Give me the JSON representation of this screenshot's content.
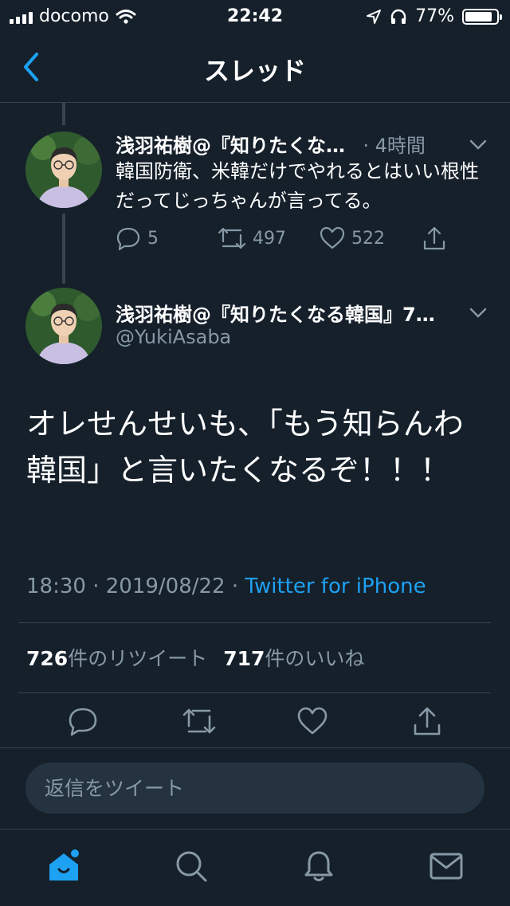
{
  "status_bar": {
    "carrier": "docomo",
    "time": "22:42",
    "battery": "77%"
  },
  "nav": {
    "title": "スレッド"
  },
  "reply_tweet": {
    "name": "浅羽祐樹@『知りたくな…",
    "time": "· 4時間",
    "text": "韓国防衛、米韓だけでやれるとはいい根性だってじっちゃんが言ってる。",
    "replies": "5",
    "retweets": "497",
    "likes": "522"
  },
  "main_tweet": {
    "name": "浅羽祐樹@『知りたくなる韓国』7…",
    "handle": "@YukiAsaba",
    "text": "オレせんせいも、「もう知らんわ韓国」と言いたくなるぞ！！！",
    "time": "18:30",
    "date": "2019/08/22",
    "source": "Twitter for iPhone",
    "retweet_count": "726",
    "retweet_label": "件のリツイート",
    "like_count": "717",
    "like_label": "件のいいね"
  },
  "composer": {
    "placeholder": "返信をツイート"
  },
  "colors": {
    "background": "#15202b",
    "accent": "#1da1f2",
    "muted": "#8899a6",
    "divider": "#38444d"
  },
  "icons": [
    "back-chevron-icon",
    "reply-icon",
    "retweet-icon",
    "like-icon",
    "share-icon",
    "home-icon",
    "search-icon",
    "notifications-icon",
    "messages-icon"
  ]
}
